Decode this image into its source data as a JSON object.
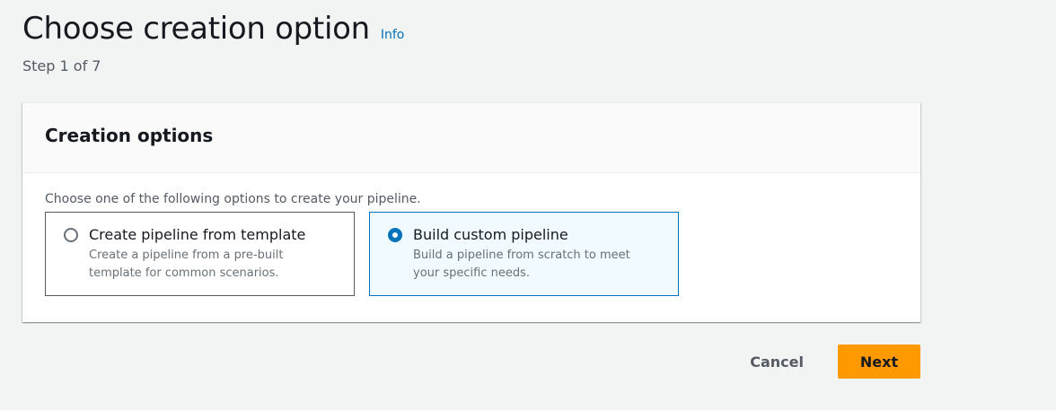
{
  "header": {
    "title": "Choose creation option",
    "info_label": "Info",
    "step": "Step 1 of 7"
  },
  "creation_options": {
    "title": "Creation options",
    "description": "Choose one of the following options to create your pipeline.",
    "options": [
      {
        "label": "Create pipeline from template",
        "description": "Create a pipeline from a pre-built template for common scenarios.",
        "selected": false
      },
      {
        "label": "Build custom pipeline",
        "description": "Build a pipeline from scratch to meet your specific needs.",
        "selected": true
      }
    ]
  },
  "actions": {
    "cancel_label": "Cancel",
    "next_label": "Next"
  },
  "colors": {
    "accent": "#0073bb",
    "primary_button": "#ff9900",
    "background": "#f2f3f3"
  }
}
